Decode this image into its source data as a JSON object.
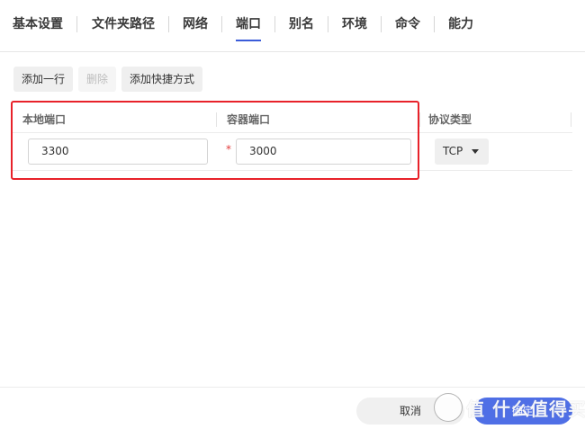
{
  "tabs": [
    {
      "label": "基本设置",
      "active": false
    },
    {
      "label": "文件夹路径",
      "active": false
    },
    {
      "label": "网络",
      "active": false
    },
    {
      "label": "端口",
      "active": true
    },
    {
      "label": "别名",
      "active": false
    },
    {
      "label": "环境",
      "active": false
    },
    {
      "label": "命令",
      "active": false
    },
    {
      "label": "能力",
      "active": false
    }
  ],
  "toolbar": {
    "add_row_label": "添加一行",
    "delete_label": "删除",
    "add_shortcut_label": "添加快捷方式"
  },
  "table": {
    "columns": [
      "本地端口",
      "容器端口",
      "协议类型"
    ],
    "rows": [
      {
        "local_port": "3300",
        "container_port": "3000",
        "required_mark": "*",
        "protocol": "TCP"
      }
    ]
  },
  "footer": {
    "cancel_label": "取消",
    "confirm_label": "确定"
  },
  "watermark": {
    "text": "值 什么值得买"
  },
  "colors": {
    "accent": "#3b5cd9",
    "confirm": "#4f6fe6",
    "highlight": "#e8222a",
    "required": "#e23b3b"
  }
}
